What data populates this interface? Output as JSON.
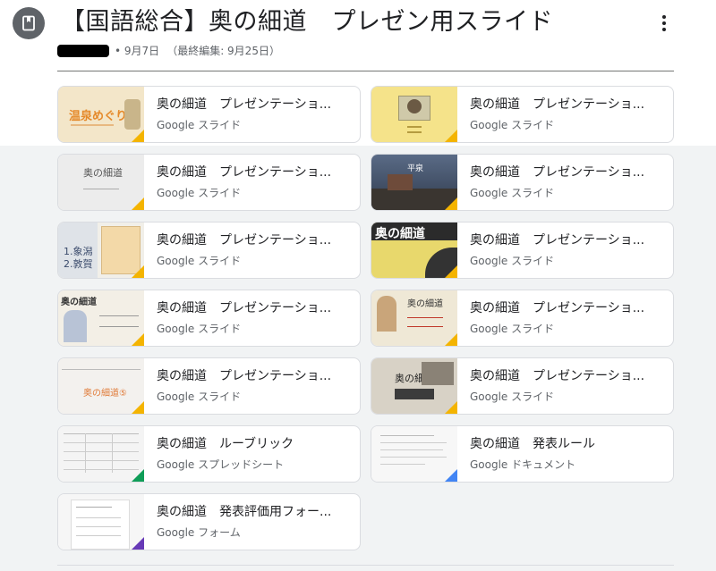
{
  "header": {
    "icon": "classwork-icon",
    "title": "【国語総合】奥の細道　プレゼン用スライド",
    "posted_date": "9月7日",
    "edited": "（最終編集: 9月25日）",
    "more_icon": "more-vert-icon"
  },
  "attachments": [
    {
      "title": "奥の細道　プレゼンテーショ...",
      "type": "Google スライド",
      "thumb_text": "温泉めぐり",
      "corner_color": "#f4b400"
    },
    {
      "title": "奥の細道　プレゼンテーショ...",
      "type": "Google スライド",
      "thumb_text": "",
      "corner_color": "#f4b400"
    },
    {
      "title": "奥の細道　プレゼンテーショ...",
      "type": "Google スライド",
      "thumb_text": "奥の細道",
      "corner_color": "#f4b400"
    },
    {
      "title": "奥の細道　プレゼンテーショ...",
      "type": "Google スライド",
      "thumb_text": "平泉",
      "corner_color": "#f4b400"
    },
    {
      "title": "奥の細道　プレゼンテーショ...",
      "type": "Google スライド",
      "thumb_text": "1.象潟\n2.敦賀",
      "corner_color": "#f4b400"
    },
    {
      "title": "奥の細道　プレゼンテーショ...",
      "type": "Google スライド",
      "thumb_text": "奥の細道",
      "corner_color": "#f4b400"
    },
    {
      "title": "奥の細道　プレゼンテーショ...",
      "type": "Google スライド",
      "thumb_text": "奥の細道",
      "corner_color": "#f4b400"
    },
    {
      "title": "奥の細道　プレゼンテーショ...",
      "type": "Google スライド",
      "thumb_text": "奥の細道",
      "corner_color": "#f4b400"
    },
    {
      "title": "奥の細道　プレゼンテーショ...",
      "type": "Google スライド",
      "thumb_text": "奥の細道⑤",
      "corner_color": "#f4b400"
    },
    {
      "title": "奥の細道　プレゼンテーショ...",
      "type": "Google スライド",
      "thumb_text": "奥の細道",
      "corner_color": "#f4b400"
    },
    {
      "title": "奥の細道　ルーブリック",
      "type": "Google スプレッドシート",
      "thumb_text": "",
      "corner_color": "#0f9d58"
    },
    {
      "title": "奥の細道　発表ルール",
      "type": "Google ドキュメント",
      "thumb_text": "",
      "corner_color": "#4285f4"
    },
    {
      "title": "奥の細道　発表評価用フォー...",
      "type": "Google フォーム",
      "thumb_text": "",
      "corner_color": "#673ab7"
    }
  ]
}
